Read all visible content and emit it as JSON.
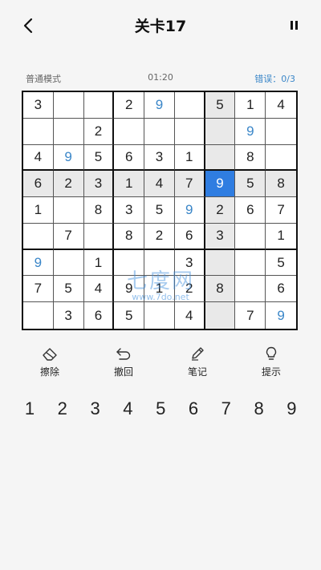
{
  "header": {
    "title": "关卡17"
  },
  "info": {
    "mode": "普通模式",
    "timer": "01:20",
    "errors": "错误：0/3"
  },
  "board": {
    "rows": [
      [
        "3",
        "",
        "",
        "2",
        "9",
        "",
        "5",
        "1",
        "4"
      ],
      [
        "",
        "",
        "2",
        "",
        "",
        "",
        "",
        "9",
        ""
      ],
      [
        "4",
        "9",
        "5",
        "6",
        "3",
        "1",
        "",
        "8",
        ""
      ],
      [
        "6",
        "2",
        "3",
        "1",
        "4",
        "7",
        "9",
        "5",
        "8"
      ],
      [
        "1",
        "",
        "8",
        "3",
        "5",
        "9",
        "2",
        "6",
        "7"
      ],
      [
        "",
        "7",
        "",
        "8",
        "2",
        "6",
        "3",
        "",
        "1"
      ],
      [
        "9",
        "",
        "1",
        "",
        "",
        "3",
        "",
        "",
        "5"
      ],
      [
        "7",
        "5",
        "4",
        "9",
        "1",
        "2",
        "8",
        "",
        "6"
      ],
      [
        "",
        "3",
        "6",
        "5",
        "",
        "4",
        "",
        "7",
        "9"
      ]
    ],
    "user_entered": [
      [
        0,
        4
      ],
      [
        1,
        7
      ],
      [
        2,
        1
      ],
      [
        3,
        6
      ],
      [
        4,
        5
      ],
      [
        6,
        0
      ],
      [
        8,
        8
      ]
    ],
    "selected": [
      3,
      6
    ],
    "colors": {
      "selected": "#2f7de1",
      "highlight": "#e9e9e9",
      "user_digit": "#3a86c8"
    }
  },
  "watermark": {
    "big": "七度网",
    "small": "www.7do.net"
  },
  "tools": [
    {
      "label": "擦除",
      "icon": "eraser-icon"
    },
    {
      "label": "撤回",
      "icon": "undo-icon"
    },
    {
      "label": "笔记",
      "icon": "pencil-icon"
    },
    {
      "label": "提示",
      "icon": "lightbulb-icon"
    }
  ],
  "numpad": [
    "1",
    "2",
    "3",
    "4",
    "5",
    "6",
    "7",
    "8",
    "9"
  ]
}
